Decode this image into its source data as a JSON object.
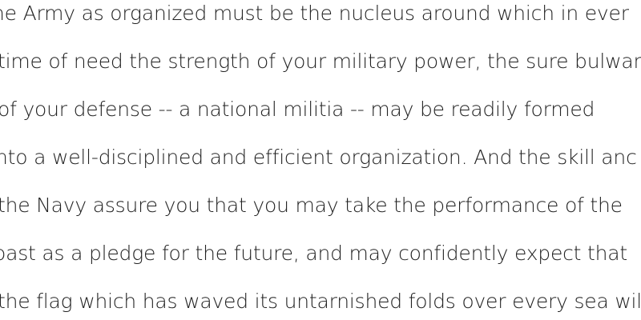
{
  "document": {
    "lines": [
      "he Army as organized must be the nucleus around which in ever",
      "time of need the strength of your military power, the sure bulwar",
      "of your defense -- a national militia -- may be readily formed",
      "nto a well-disciplined and efficient organization. And the skill anc",
      "the Navy assure you that you may take the performance of the",
      "oast as a pledge for the future, and may confidently expect that",
      "the flag which has waved its untarnished folds over every sea wil"
    ]
  }
}
